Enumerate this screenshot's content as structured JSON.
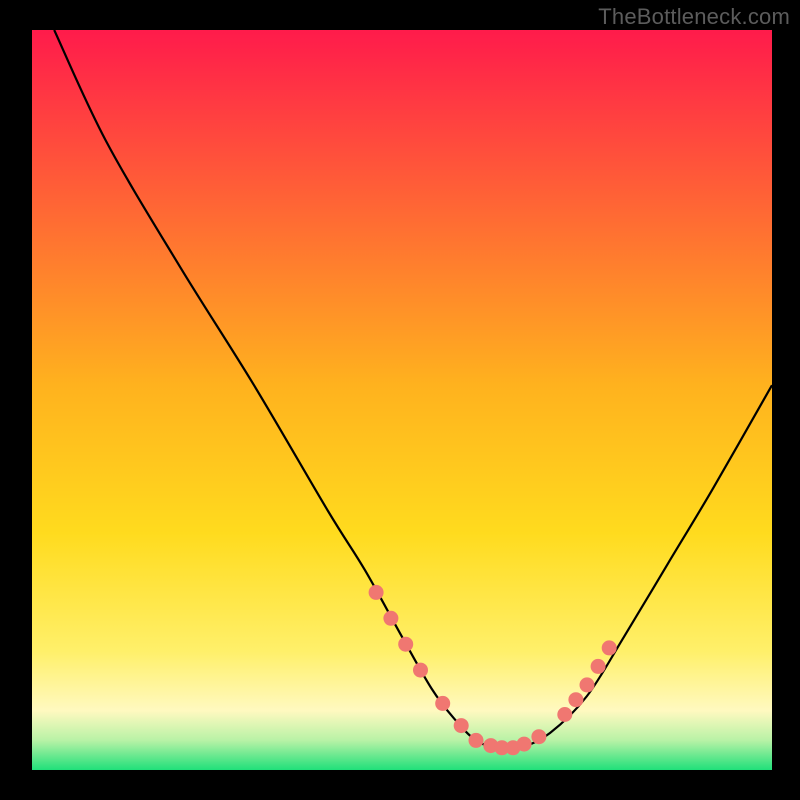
{
  "attribution": "TheBottleneck.com",
  "colors": {
    "top": "#ff1b4b",
    "mid": "#ffdb1e",
    "nearBottom": "#fff9c0",
    "bottom": "#20e07a",
    "curve": "#000000",
    "marker": "#f07771"
  },
  "chart_data": {
    "type": "line",
    "title": "",
    "xlabel": "",
    "ylabel": "",
    "xlim": [
      0,
      100
    ],
    "ylim": [
      0,
      100
    ],
    "grid": false,
    "series": [
      {
        "name": "bottleneck-curve",
        "x": [
          3,
          10,
          20,
          30,
          40,
          45,
          50,
          54,
          57,
          60,
          63,
          66,
          70,
          75,
          80,
          86,
          92,
          100
        ],
        "y": [
          100,
          85,
          68,
          52,
          35,
          27,
          18,
          11,
          7,
          4,
          3,
          3,
          5,
          10,
          18,
          28,
          38,
          52
        ]
      }
    ],
    "markers": {
      "name": "highlight-dots",
      "color": "#f07771",
      "x": [
        46.5,
        48.5,
        50.5,
        52.5,
        55.5,
        58.0,
        60.0,
        62.0,
        63.5,
        65.0,
        66.5,
        68.5,
        72.0,
        73.5,
        75.0,
        76.5,
        78.0
      ],
      "y": [
        24.0,
        20.5,
        17.0,
        13.5,
        9.0,
        6.0,
        4.0,
        3.3,
        3.0,
        3.0,
        3.5,
        4.5,
        7.5,
        9.5,
        11.5,
        14.0,
        16.5
      ]
    }
  }
}
